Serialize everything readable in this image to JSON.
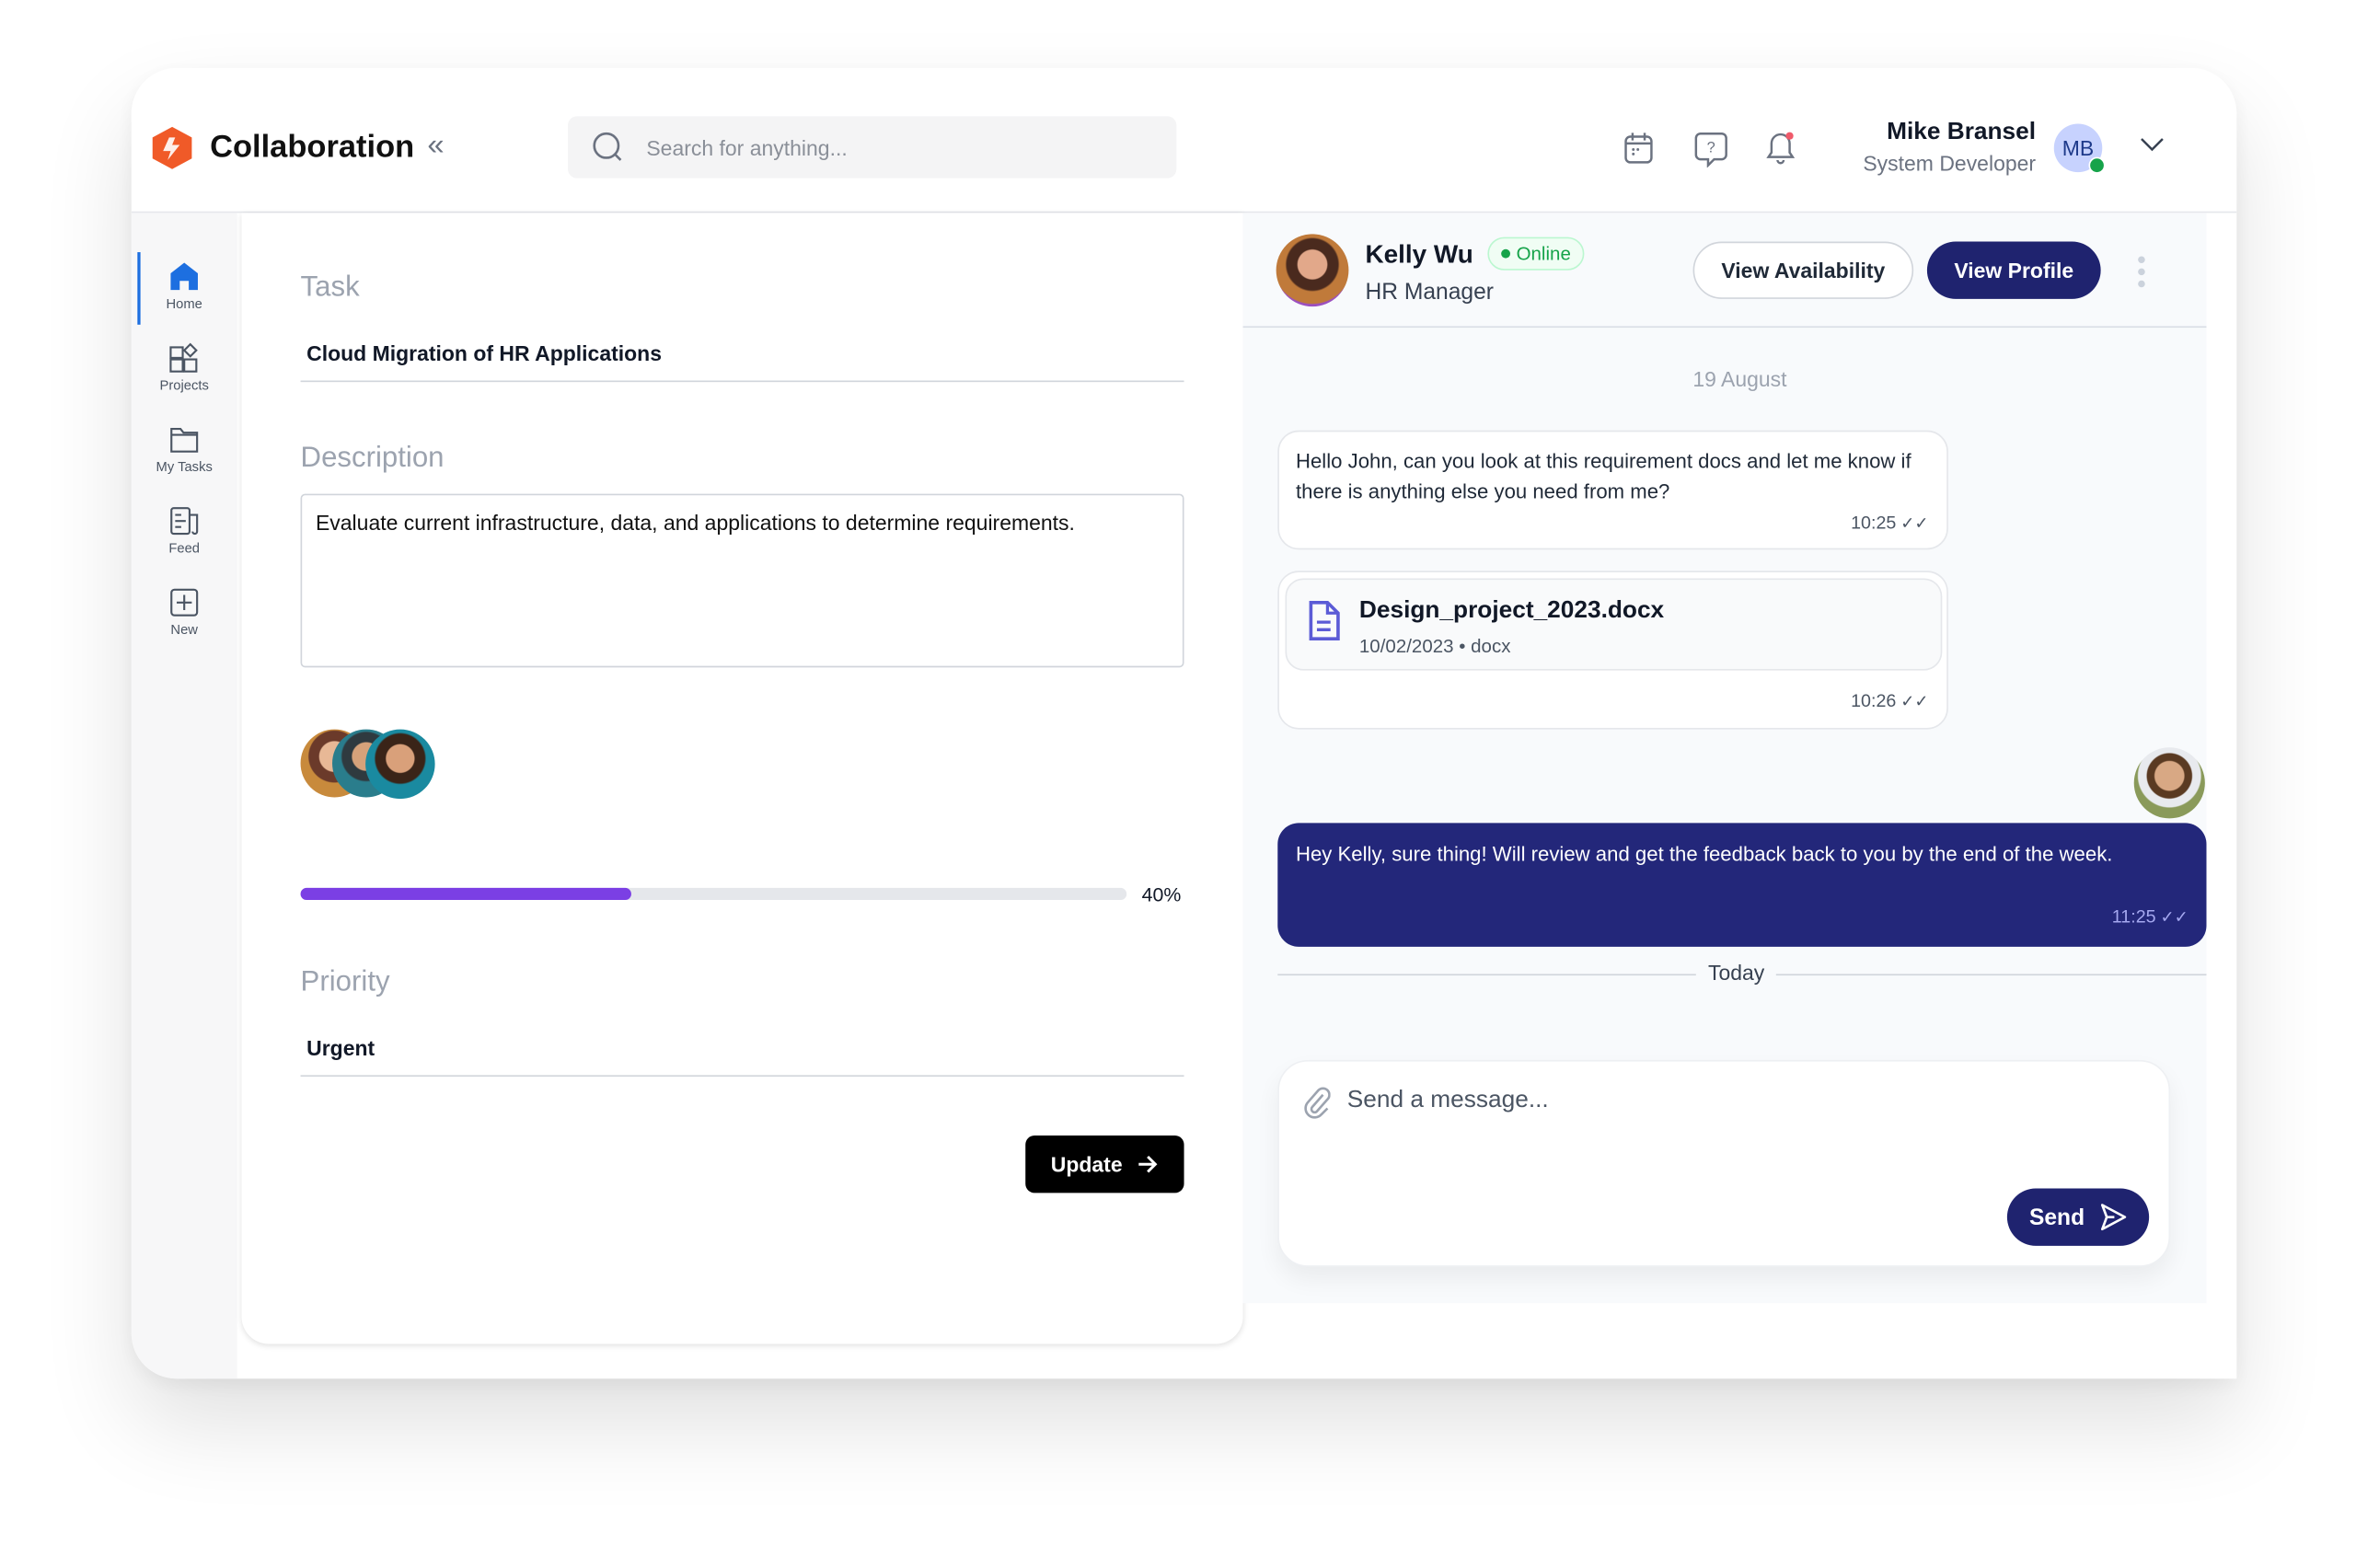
{
  "app": {
    "title": "Collaboration",
    "collapse_icon": "double-chevron-left-icon"
  },
  "search": {
    "placeholder": "Search for anything..."
  },
  "header_icons": [
    "calendar-icon",
    "help-chat-icon",
    "bell-icon"
  ],
  "user": {
    "name": "Mike Bransel",
    "role": "System Developer",
    "initials": "MB",
    "status": "online"
  },
  "sidebar": {
    "items": [
      {
        "label": "Home",
        "icon": "home-icon",
        "active": true
      },
      {
        "label": "Projects",
        "icon": "projects-icon"
      },
      {
        "label": "My Tasks",
        "icon": "folder-icon"
      },
      {
        "label": "Feed",
        "icon": "feed-icon"
      },
      {
        "label": "New",
        "icon": "plus-square-icon"
      }
    ]
  },
  "task": {
    "task_label": "Task",
    "task_value": "Cloud Migration of HR Applications",
    "description_label": "Description",
    "description_value": "Evaluate current infrastructure, data, and applications to determine requirements.",
    "progress": 40,
    "progress_text": "40%",
    "priority_label": "Priority",
    "priority_value": "Urgent",
    "update_label": "Update"
  },
  "colors": {
    "accent": "#7b3fe4",
    "navy": "#1f236f",
    "bubble_navy": "#23277a",
    "online": "#16a34a",
    "logo": "#f05a28"
  },
  "chat": {
    "contact": {
      "name": "Kelly Wu",
      "status": "Online",
      "role": "HR Manager"
    },
    "view_availability": "View Availability",
    "view_profile": "View Profile",
    "date_label": "19 August",
    "messages": [
      {
        "text": "Hello John, can you look at this requirement docs and let me know if there is anything else you need from me?",
        "time": "10:25"
      },
      {
        "file_name": "Design_project_2023.docx",
        "file_meta": "10/02/2023 • docx",
        "time": "10:26"
      },
      {
        "text": "Hey Kelly, sure thing! Will review and get the feedback back to you by the end of the week.",
        "time": "11:25"
      }
    ],
    "today_label": "Today",
    "input_placeholder": "Send a message...",
    "send_label": "Send"
  }
}
